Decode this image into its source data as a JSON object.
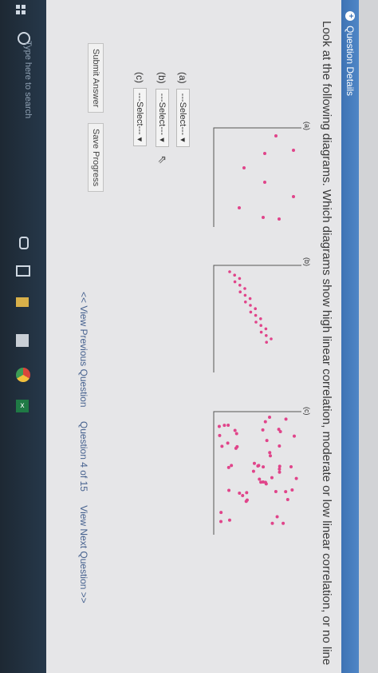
{
  "taskbar": {
    "search_placeholder": "Type here to search"
  },
  "header": {
    "title": "Question Details",
    "icon": "plus-circle-icon"
  },
  "question": {
    "prompt": "Look at the following diagrams. Which diagrams show high linear correlation, moderate or low linear correlation, or no line"
  },
  "diagrams": [
    {
      "label": "(a)"
    },
    {
      "label": "(b)"
    },
    {
      "label": "(c)"
    }
  ],
  "answers": [
    {
      "label": "(a)",
      "value": "---Select---"
    },
    {
      "label": "(b)",
      "value": "---Select---"
    },
    {
      "label": "(c)",
      "value": "---Select---"
    }
  ],
  "buttons": {
    "submit": "Submit Answer",
    "save": "Save Progress"
  },
  "navigation": {
    "previous": "<< View Previous Question",
    "position": "Question 4 of 15",
    "next": "View Next Question >>"
  },
  "colors": {
    "header_bar": "#3e73b4",
    "dot": "#e0448a",
    "taskbar": "#1d2833"
  }
}
